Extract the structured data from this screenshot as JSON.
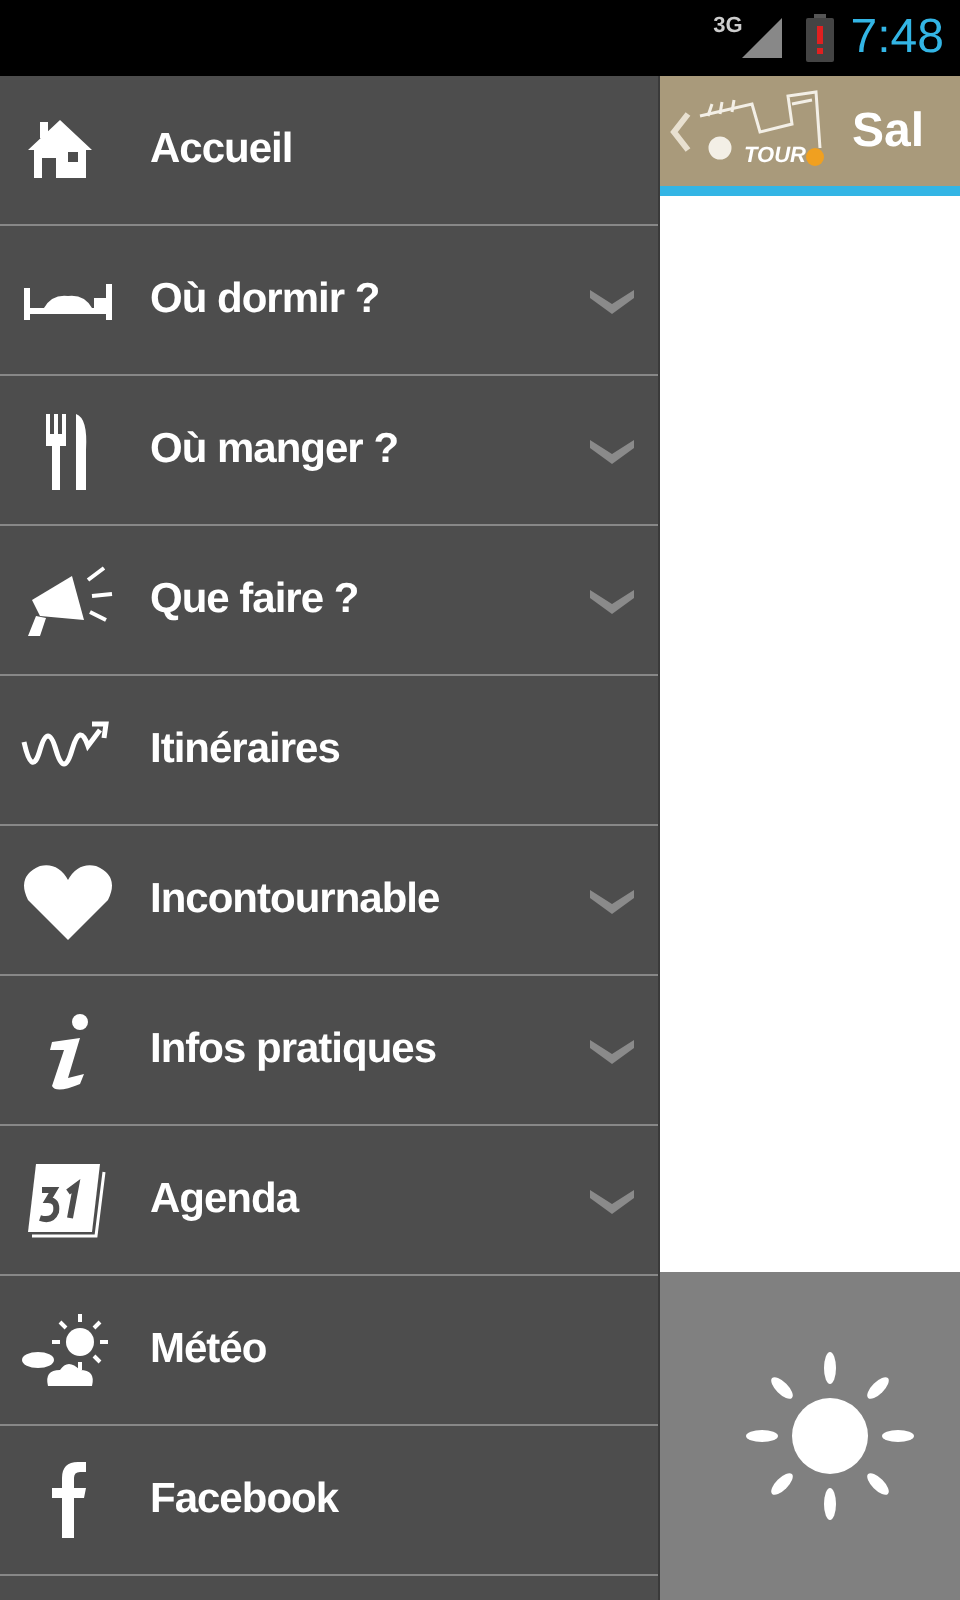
{
  "status_bar": {
    "network": "3G",
    "time": "7:48"
  },
  "drawer": {
    "items": [
      {
        "label": "Accueil",
        "expandable": false
      },
      {
        "label": "Où dormir ?",
        "expandable": true
      },
      {
        "label": "Où manger ?",
        "expandable": true
      },
      {
        "label": "Que faire ?",
        "expandable": true
      },
      {
        "label": "Itinéraires",
        "expandable": false
      },
      {
        "label": "Incontournable",
        "expandable": true
      },
      {
        "label": "Infos pratiques",
        "expandable": true
      },
      {
        "label": "Agenda",
        "expandable": true
      },
      {
        "label": "Météo",
        "expandable": false
      },
      {
        "label": "Facebook",
        "expandable": false
      }
    ]
  },
  "header": {
    "logo_text": "TOUR",
    "title": "Sal"
  }
}
